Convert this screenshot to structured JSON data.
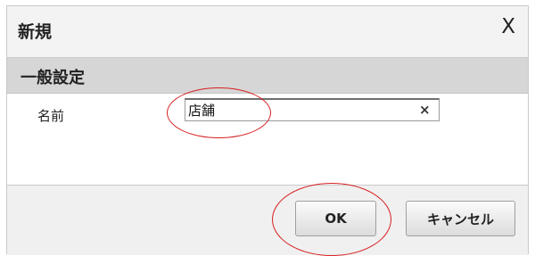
{
  "dialog": {
    "title": "新規",
    "close_glyph": "X",
    "section_title": "一般設定",
    "name_label": "名前",
    "name_value": "店舗",
    "clear_glyph": "×",
    "ok_label": "OK",
    "cancel_label": "キャンセル"
  },
  "annotations": {
    "color": "#d62020"
  }
}
